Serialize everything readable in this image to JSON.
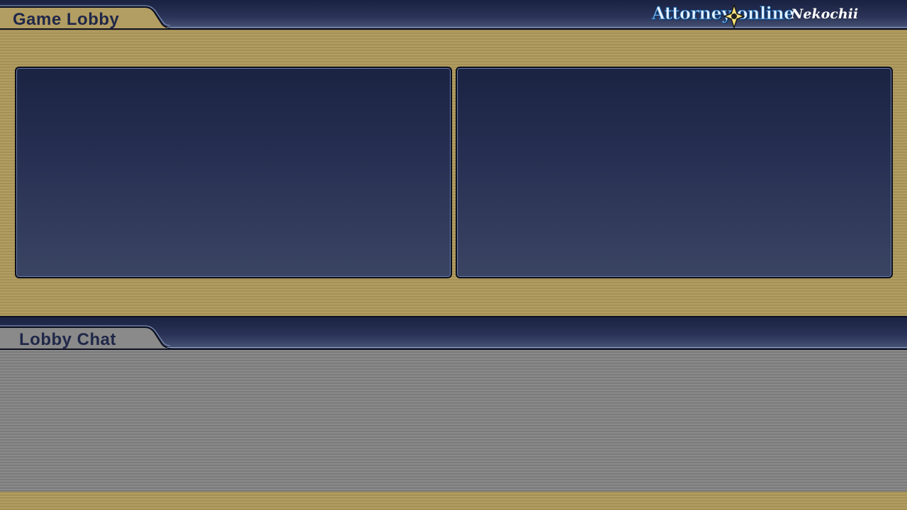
{
  "lobby": {
    "title": "Game Lobby"
  },
  "chat": {
    "title": "Lobby Chat"
  },
  "logo": {
    "text": "Attorney online",
    "subtitle": "Nekochii"
  },
  "colors": {
    "background": "#b29d62",
    "bar": "#1a2141",
    "panel": "#1b2343",
    "chat": "#8a8a8a",
    "title": "#1f2749"
  }
}
